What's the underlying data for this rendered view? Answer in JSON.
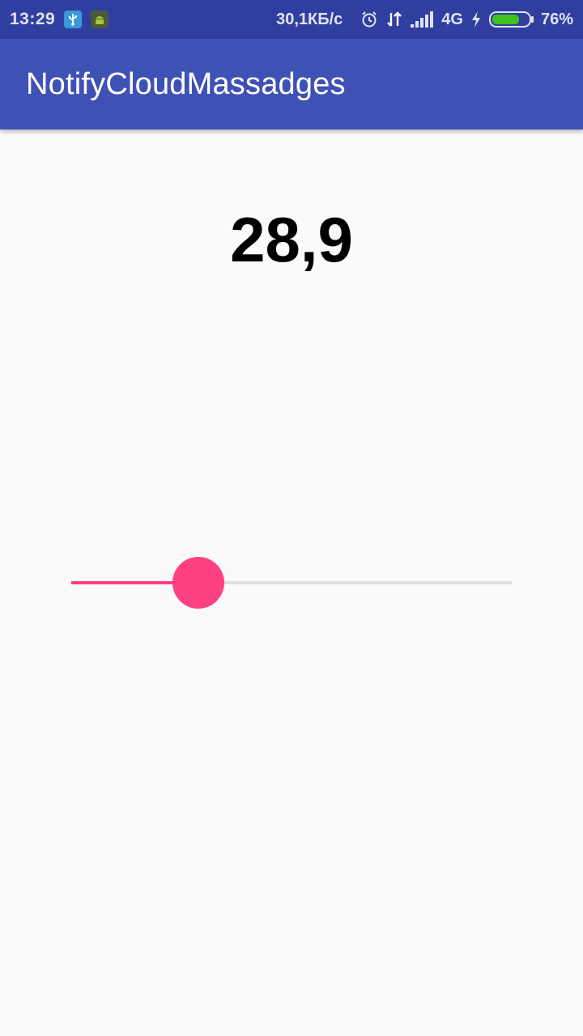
{
  "status_bar": {
    "time": "13:29",
    "network_speed": "30,1КБ/с",
    "network_type": "4G",
    "battery_percent": "76%",
    "battery_level": 0.76,
    "icons": [
      "usb-icon",
      "android-icon",
      "alarm-icon",
      "data-arrows-icon",
      "signal-icon",
      "charging-icon",
      "battery-icon"
    ]
  },
  "app_bar": {
    "title": "NotifyCloudMassadges"
  },
  "main": {
    "value": "28,9",
    "slider": {
      "fraction": 0.289,
      "color": "#ff4081",
      "track_color": "#dedede"
    }
  },
  "colors": {
    "status_bar": "#303f9f",
    "app_bar": "#3f51b5",
    "accent": "#ff4081",
    "background": "#fafafa"
  }
}
